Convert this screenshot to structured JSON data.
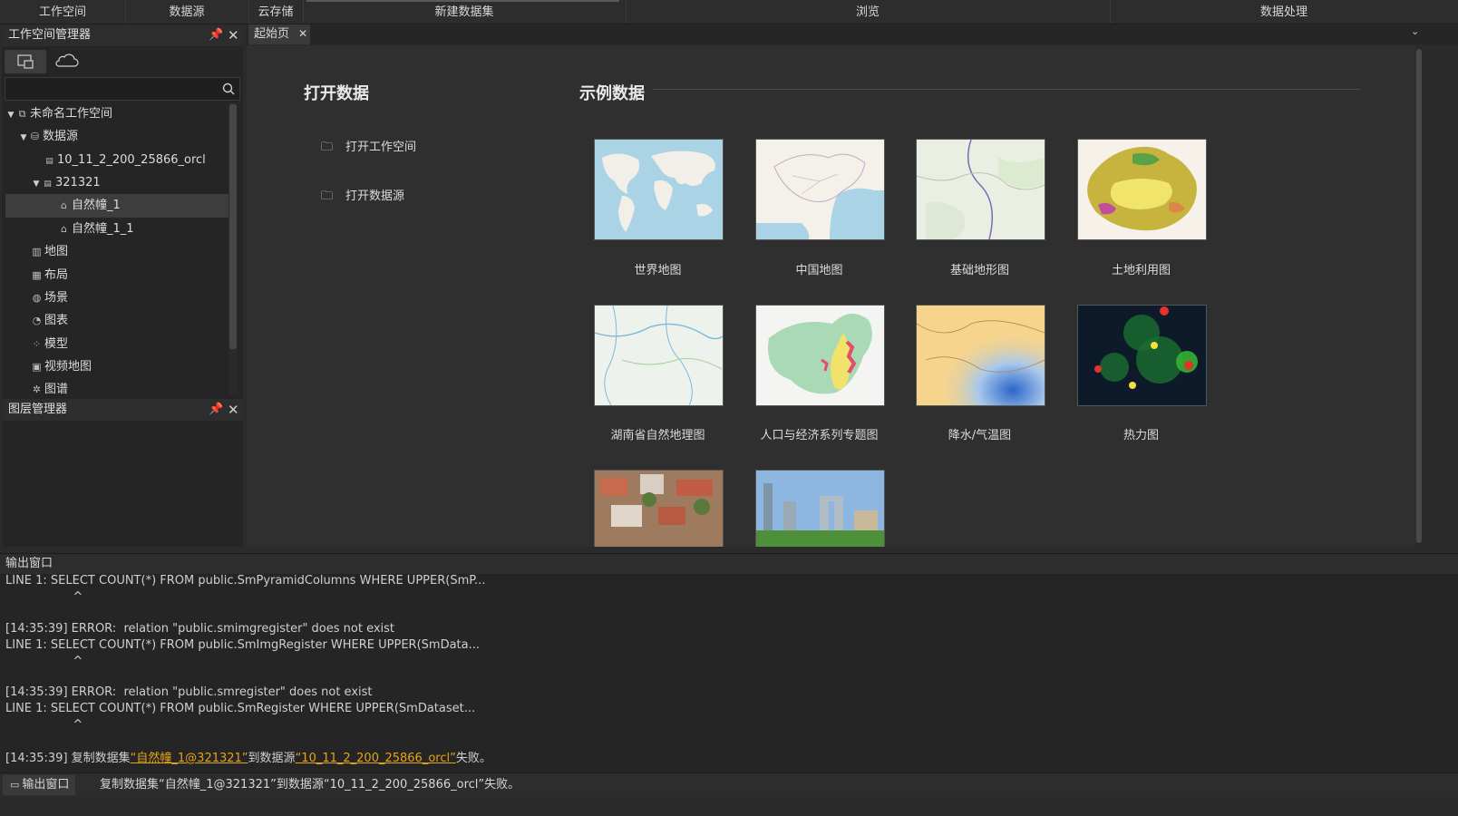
{
  "ribbon": {
    "groups": [
      "工作空间",
      "数据源",
      "云存储",
      "新建数据集",
      "浏览",
      "数据处理"
    ]
  },
  "workspace_panel": {
    "title": "工作空间管理器",
    "search_placeholder": "",
    "tree": [
      {
        "label": "未命名工作空间",
        "icon": "workspace-icon"
      },
      {
        "label": "数据源",
        "icon": "datasource-icon"
      },
      {
        "label": "10_11_2_200_25866_orcl",
        "icon": "pgis-datasource-icon"
      },
      {
        "label": "321321",
        "icon": "udbx-datasource-icon"
      },
      {
        "label": "自然幢_1",
        "icon": "region-dataset-icon"
      },
      {
        "label": "自然幢_1_1",
        "icon": "region-dataset-icon"
      },
      {
        "label": "地图",
        "icon": "map-icon"
      },
      {
        "label": "布局",
        "icon": "layout-icon"
      },
      {
        "label": "场景",
        "icon": "scene-icon"
      },
      {
        "label": "图表",
        "icon": "chart-icon"
      },
      {
        "label": "模型",
        "icon": "model-icon"
      },
      {
        "label": "视频地图",
        "icon": "video-map-icon"
      },
      {
        "label": "图谱",
        "icon": "graph-icon"
      }
    ]
  },
  "layer_panel": {
    "title": "图层管理器"
  },
  "tabs": {
    "active": "起始页"
  },
  "start_page": {
    "open_title": "打开数据",
    "open_workspace": "打开工作空间",
    "open_datasource": "打开数据源",
    "sample_title": "示例数据",
    "samples": [
      "世界地图",
      "中国地图",
      "基础地形图",
      "土地利用图",
      "湖南省自然地理图",
      "人口与经济系列专题图",
      "降水/气温图",
      "热力图"
    ]
  },
  "output": {
    "title": "输出窗口",
    "lines": [
      "LINE 1: SELECT COUNT(*) FROM public.SmPyramidColumns WHERE UPPER(SmP...",
      "                  ^",
      "[14:35:39] ERROR:  relation \"public.smimgregister\" does not exist",
      "LINE 1: SELECT COUNT(*) FROM public.SmImgRegister WHERE UPPER(SmData...",
      "                  ^",
      "[14:35:39] ERROR:  relation \"public.smregister\" does not exist",
      "LINE 1: SELECT COUNT(*) FROM public.SmRegister WHERE UPPER(SmDataset...",
      "                  ^"
    ],
    "last_prefix": "[14:35:39] 复制数据集",
    "last_link1": "“自然幢_1@321321”",
    "last_mid": "到数据源",
    "last_link2": "“10_11_2_200_25866_orcl”",
    "last_suffix": "失败。"
  },
  "status": {
    "output_tab": "输出窗口",
    "message": "复制数据集“自然幢_1@321321”到数据源“10_11_2_200_25866_orcl”失败。"
  },
  "colors": {
    "link": "#e6a417",
    "selection": "#3d3d3d"
  }
}
